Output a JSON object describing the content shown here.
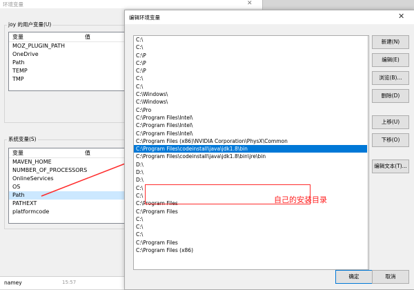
{
  "env_window": {
    "title": "环境变量",
    "close_glyph": "✕",
    "user_group_label": "joy 的用户变量(U)",
    "user_header": {
      "var": "变量",
      "val": "值"
    },
    "user_vars": [
      {
        "name": "MOZ_PLUGIN_PATH"
      },
      {
        "name": "OneDrive"
      },
      {
        "name": "Path"
      },
      {
        "name": "TEMP"
      },
      {
        "name": "TMP"
      }
    ],
    "sys_group_label": "系统变量(S)",
    "sys_header": {
      "var": "变量",
      "val": "值"
    },
    "sys_vars": [
      {
        "name": "MAVEN_HOME"
      },
      {
        "name": "NUMBER_OF_PROCESSORS"
      },
      {
        "name": "OnlineServices"
      },
      {
        "name": "OS"
      },
      {
        "name": "Path"
      },
      {
        "name": "PATHEXT"
      },
      {
        "name": "platformcode"
      }
    ]
  },
  "dialog": {
    "title": "编辑环境变量",
    "close_glyph": "✕",
    "path_entries": [
      "C:\\",
      "C:\\",
      "C:\\P",
      "C:\\P",
      "C:\\P",
      "C:\\",
      "C:\\",
      "C:\\Windows\\",
      "C:\\Windows\\",
      "C:\\Pro",
      "C:\\Program Files\\Intel\\",
      "C:\\Program Files\\Intel\\",
      "C:\\Program Files\\Intel\\",
      "C:\\Program Files (x86)\\NVIDIA Corporation\\PhysX\\Common",
      "C:\\Program Files\\codeinstall\\java\\jdk1.8\\bin",
      "C:\\Program Files\\codeinstall\\java\\jdk1.8\\bin\\jre\\bin",
      "D:\\",
      "D:\\",
      "D:\\",
      "C:\\",
      "C:\\",
      "C:\\Program Files",
      "C:\\Program Files",
      "C:\\",
      "C:\\",
      "C:\\",
      "C:\\Program Files",
      "C:\\Program Files (x86)"
    ],
    "selected_index": 14,
    "buttons": {
      "new": "新建(N)",
      "edit": "编辑(E)",
      "browse": "浏览(B)...",
      "delete": "删除(D)",
      "up": "上移(U)",
      "down": "下移(O)",
      "edit_text": "编辑文本(T)...",
      "ok": "确定",
      "cancel": "取消"
    },
    "scroll_up_glyph": "▲",
    "scroll_down_glyph": "▼"
  },
  "annotation": {
    "text": "自己的安装目录",
    "color": "#ff2020"
  },
  "taskbar": {
    "name": "namey",
    "time": "15:57"
  },
  "colors": {
    "selection": "#0078d7",
    "accent": "#ff2a2a"
  }
}
